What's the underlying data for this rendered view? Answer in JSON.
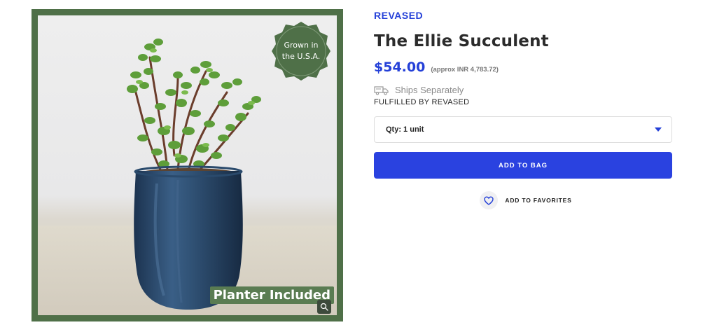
{
  "gallery": {
    "badge_text": "Grown in the U.S.A.",
    "planter_tag": "Planter Included",
    "zoom_icon": "magnifier-icon"
  },
  "product": {
    "brand": "REVASED",
    "title": "The Ellie Succulent",
    "price": "$54.00",
    "price_approx": "(approx INR 4,783.72)",
    "shipping": {
      "icon": "truck-icon",
      "text": "Ships Separately"
    },
    "fulfilled_by": "FULFILLED BY REVASED",
    "quantity": {
      "selected": "Qty: 1 unit"
    },
    "add_to_bag_label": "ADD TO BAG",
    "favorites": {
      "icon": "heart-icon",
      "label": "ADD TO FAVORITES"
    }
  },
  "colors": {
    "accent": "#2a42e0",
    "frame_green": "#4f7048",
    "planter_blue": "#2b4a6e"
  }
}
